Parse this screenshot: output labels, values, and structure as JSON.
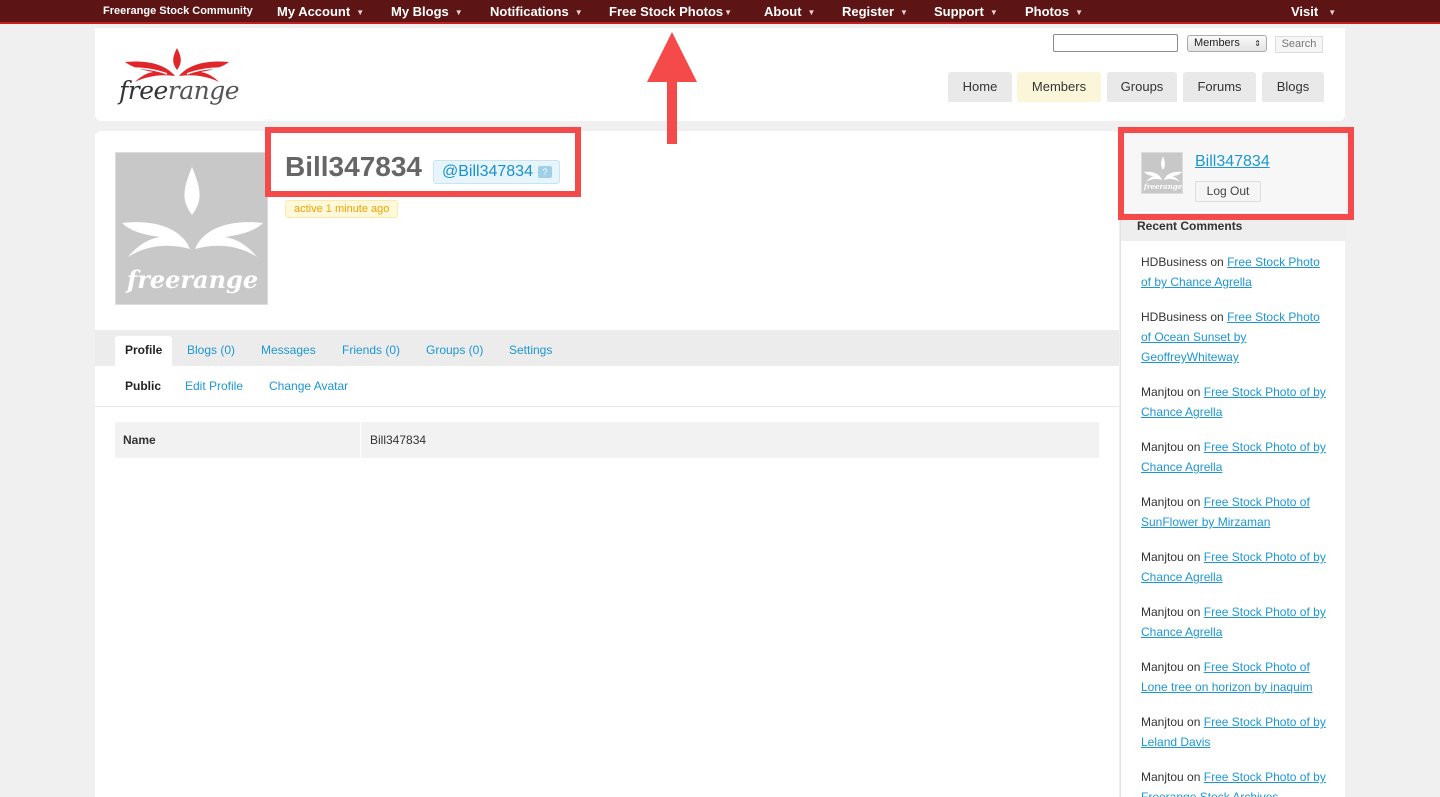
{
  "adminbar": {
    "brand": "Freerange Stock Community",
    "items": [
      {
        "label": "My Account"
      },
      {
        "label": "My Blogs"
      },
      {
        "label": "Notifications"
      },
      {
        "label": "Free Stock Photos"
      },
      {
        "label": "About"
      },
      {
        "label": "Register"
      },
      {
        "label": "Support"
      },
      {
        "label": "Photos"
      },
      {
        "label": "Visit"
      }
    ]
  },
  "header": {
    "logo_text_a": "free",
    "logo_text_b": "range",
    "search": {
      "value": "",
      "scope": "Members",
      "button": "Search"
    },
    "nav": [
      {
        "label": "Home"
      },
      {
        "label": "Members"
      },
      {
        "label": "Groups"
      },
      {
        "label": "Forums"
      },
      {
        "label": "Blogs"
      }
    ]
  },
  "profile": {
    "display_name": "Bill347834",
    "mention": "@Bill347834",
    "help_label": "?",
    "activity": "active 1 minute ago",
    "avatar_text": "freerange",
    "tabs": [
      {
        "label": "Profile"
      },
      {
        "label": "Blogs (0)"
      },
      {
        "label": "Messages"
      },
      {
        "label": "Friends (0)"
      },
      {
        "label": "Groups (0)"
      },
      {
        "label": "Settings"
      }
    ],
    "subtabs": [
      {
        "label": "Public"
      },
      {
        "label": "Edit Profile"
      },
      {
        "label": "Change Avatar"
      }
    ],
    "fields": [
      {
        "label": "Name",
        "value": "Bill347834"
      }
    ]
  },
  "sidebar": {
    "user_name": "Bill347834",
    "logout": "Log Out",
    "avatar_text": "freerange",
    "recent_title": "Recent Comments",
    "comments": [
      {
        "author": "HDBusiness",
        "on": "on",
        "link": "Free Stock Photo of by Chance Agrella"
      },
      {
        "author": "HDBusiness",
        "on": "on",
        "link": "Free Stock Photo of Ocean Sunset by GeoffreyWhiteway"
      },
      {
        "author": "Manjtou",
        "on": "on",
        "link": "Free Stock Photo of by Chance Agrella"
      },
      {
        "author": "Manjtou",
        "on": "on",
        "link": "Free Stock Photo of by Chance Agrella"
      },
      {
        "author": "Manjtou",
        "on": "on",
        "link": "Free Stock Photo of SunFlower by Mirzaman"
      },
      {
        "author": "Manjtou",
        "on": "on",
        "link": "Free Stock Photo of by Chance Agrella"
      },
      {
        "author": "Manjtou",
        "on": "on",
        "link": "Free Stock Photo of by Chance Agrella"
      },
      {
        "author": "Manjtou",
        "on": "on",
        "link": "Free Stock Photo of Lone tree on horizon by inaquim"
      },
      {
        "author": "Manjtou",
        "on": "on",
        "link": "Free Stock Photo of by Leland Davis"
      },
      {
        "author": "Manjtou",
        "on": "on",
        "link": "Free Stock Photo of by Freerange Stock Archives"
      }
    ]
  },
  "colors": {
    "adminbar": "#5c1414",
    "link": "#1c97d3",
    "annotation": "#f54a4a",
    "activity": "#f0a100"
  }
}
